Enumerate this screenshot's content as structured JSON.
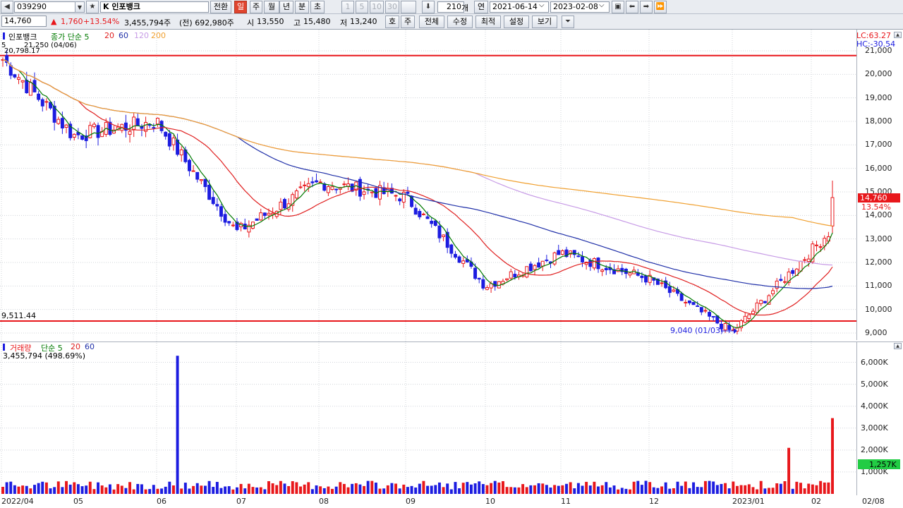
{
  "toolbar": {
    "code": "039290",
    "market_prefix": "K",
    "stock_name": "인포뱅크",
    "switch_btn": "전환",
    "period_buttons": [
      "일",
      "주",
      "월",
      "년",
      "분",
      "초"
    ],
    "selected_period": "일",
    "minute_buttons": [
      "1",
      "5",
      "10",
      "30"
    ],
    "count_value": "210",
    "count_unit": "개",
    "year_label": "연",
    "start_date": "2021-06-14",
    "end_date": "2023-02-08"
  },
  "quote": {
    "price": "14,760",
    "change": "1,760",
    "change_pct": "+13.54%",
    "volume": "3,455,794주",
    "prev_volume": "(전) 692,980주",
    "open_label": "시",
    "open": "13,550",
    "high_label": "고",
    "high": "15,480",
    "low_label": "저",
    "low": "13,240",
    "buttons": [
      "호",
      "주",
      "전체",
      "수정",
      "최적",
      "설정",
      "보기"
    ]
  },
  "price_pane": {
    "name": "인포뱅크",
    "ma_label": "종가 단순",
    "ma_periods": [
      "5",
      "20",
      "60",
      "120",
      "200"
    ],
    "ma_colors": [
      "#007a00",
      "#e02020",
      "#1f2fa8",
      "#c79be6",
      "#f0a030"
    ],
    "high_note": "21,250 (04/06)",
    "high_note_prefix": "5",
    "high_note_value2": "20,798.17",
    "low_note": "9,040 (01/03)",
    "left_line_value": "9,511.44",
    "lc": "LC:63.27",
    "hc": "HC:-30.54",
    "y_ticks": [
      "21,000",
      "20,000",
      "19,000",
      "18,000",
      "17,000",
      "16,000",
      "15,000",
      "14,000",
      "13,000",
      "12,000",
      "11,000",
      "10,000",
      "9,000"
    ],
    "last_price_tag": "14,760",
    "last_pct_tag": "13.54%"
  },
  "volume_pane": {
    "name": "거래량",
    "ma_label": "단순",
    "ma_periods": [
      "5",
      "20",
      "60"
    ],
    "value_line": "3,455,794 (498.69%)",
    "y_ticks": [
      "6,000K",
      "5,000K",
      "4,000K",
      "3,000K",
      "2,000K",
      "1,000K"
    ],
    "tag": "1,257K"
  },
  "x_axis": {
    "labels": [
      "2022/04",
      "05",
      "06",
      "07",
      "08",
      "09",
      "10",
      "11",
      "12",
      "2023/01",
      "02",
      "02/08"
    ]
  },
  "chart_data": {
    "type": "candlestick",
    "dates_range": [
      "2022-04",
      "2023-02-08"
    ],
    "last": {
      "open": 13550,
      "high": 15480,
      "low": 13240,
      "close": 14760,
      "volume": 3455794
    },
    "close_path": [
      [
        "2022/04",
        20700
      ],
      [
        "05",
        17400
      ],
      [
        "06",
        18000
      ],
      [
        "07",
        13300
      ],
      [
        "08",
        15400
      ],
      [
        "09",
        14800
      ],
      [
        "10",
        11000
      ],
      [
        "11",
        12400
      ],
      [
        "12",
        11300
      ],
      [
        "2023/01",
        9040
      ],
      [
        "02",
        12500
      ],
      [
        "02/08",
        14760
      ]
    ],
    "horizontal_lines": [
      20798.17,
      9511.44
    ],
    "volume_peaks": [
      {
        "period": "06",
        "volume": 6300000
      },
      {
        "period": "2023/01",
        "volume": 2100000
      },
      {
        "period": "02/08",
        "volume": 3455794
      }
    ],
    "ylim_price": [
      9000,
      21000
    ],
    "ylim_volume": [
      0,
      6500000
    ],
    "colors": {
      "up": "#e8171b",
      "down": "#1c1ce0",
      "hline": "#e8171b"
    }
  }
}
